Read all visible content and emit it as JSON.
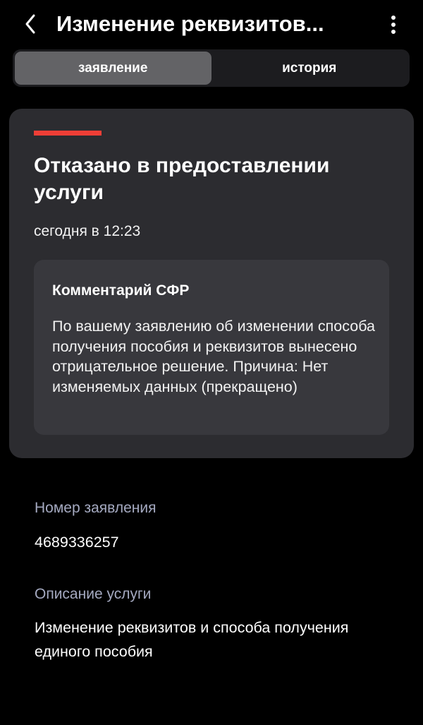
{
  "header": {
    "title": "Изменение реквизитов...",
    "back_icon": "chevron-left-icon",
    "more_icon": "vertical-ellipsis-icon"
  },
  "tabs": [
    {
      "label": "заявление",
      "active": true
    },
    {
      "label": "история",
      "active": false
    }
  ],
  "status": {
    "title": "Отказано в предоставлении услуги",
    "time": "сегодня в 12:23",
    "accent_color": "#ef3e36"
  },
  "comment": {
    "title": "Комментарий СФР",
    "text": "По вашему заявлению об изменении способа получения пособия и реквизитов вынесено отрицательное решение. Причина: Нет изменяемых данных (прекращено)"
  },
  "details": [
    {
      "label": "Номер заявления",
      "value": "4689336257"
    },
    {
      "label": "Описание услуги",
      "value": "Изменение реквизитов и способа получения единого пособия"
    }
  ]
}
